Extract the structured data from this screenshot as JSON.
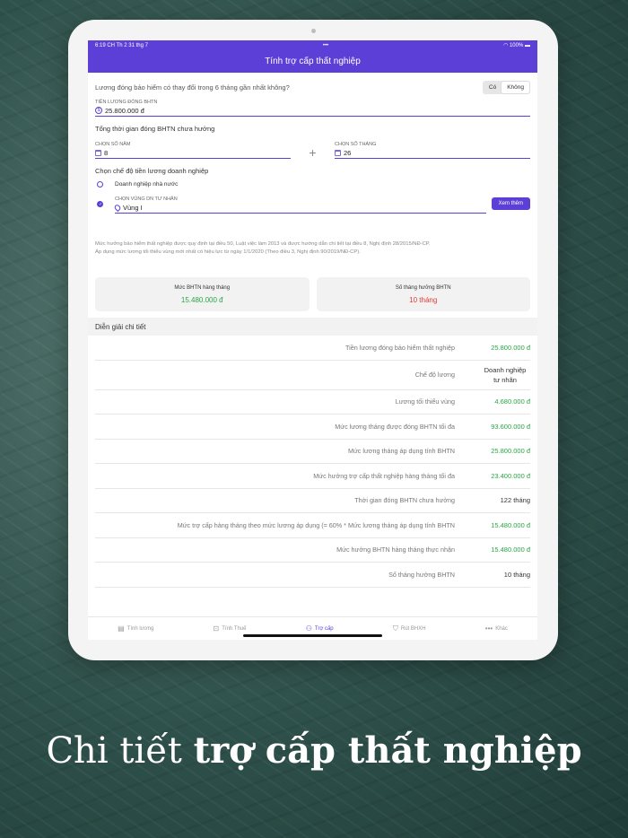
{
  "status": {
    "time": "6:19 CH",
    "date": "Th 2 31 thg 7",
    "dots": "•••",
    "battery": "100%"
  },
  "title": "Tính trợ cấp thất nghiệp",
  "question": {
    "text": "Lương đóng bảo hiểm có thay đổi trong 6 tháng gần nhất không?",
    "yes": "Có",
    "no": "Không",
    "selected": "Không"
  },
  "salary": {
    "label": "TIỀN LƯƠNG ĐÓNG BHTN",
    "value": "25.800.000 đ"
  },
  "total_time": {
    "title": "Tổng thời gian đóng BHTN chưa hưởng",
    "years_label": "CHỌN SỐ NĂM",
    "years_value": "8",
    "months_label": "CHỌN SỐ THÁNG",
    "months_value": "26",
    "plus": "+"
  },
  "regime": {
    "title": "Chọn chế độ tiền lương doanh nghiệp",
    "option_state": "Doanh nghiệp nhà nước",
    "region_label": "CHỌN VÙNG DN TƯ NHÂN",
    "region_value": "Vùng I",
    "more_button": "Xem thêm"
  },
  "note": {
    "line1": "Mức hưởng bảo hiểm thất nghiệp được quy định tại điều 50, Luật việc làm 2013 và được hướng dẫn chi tiết tại điều 8, Nghị định 28/2015/NĐ-CP.",
    "line2": "Áp dụng mức lương tối thiểu vùng mới nhất có hiệu lực từ ngày 1/1/2020 (Theo điều 3, Nghị định 90/2019/NĐ-CP)."
  },
  "cards": {
    "monthly_title": "Mức BHTN hàng tháng",
    "monthly_value": "15.480.000 đ",
    "months_title": "Số tháng hưởng BHTN",
    "months_value": "10 tháng"
  },
  "detail": {
    "header": "Diễn giải chi tiết",
    "rows": [
      {
        "label": "Tiền lương đóng bảo hiểm thất nghiệp",
        "value": "25.800.000 đ"
      },
      {
        "label": "Chế độ lương",
        "value1": "Doanh nghiệp",
        "value2": "tư nhân"
      },
      {
        "label": "Lương tối thiểu vùng",
        "value": "4.680.000 đ"
      },
      {
        "label": "Mức lương tháng được đóng BHTN tối đa",
        "value": "93.600.000 đ"
      },
      {
        "label": "Mức lương tháng áp dụng tính BHTN",
        "value": "25.800.000 đ"
      },
      {
        "label": "Mức hưởng trợ cấp thất nghiệp hàng tháng tối đa",
        "value": "23.400.000 đ"
      },
      {
        "label": "Thời gian đóng BHTN chưa hưởng",
        "value": "122 tháng"
      },
      {
        "label": "Mức trợ cấp hàng tháng theo mức lương áp dụng (= 60% * Mức lương tháng áp dụng tính BHTN",
        "value": "15.480.000 đ"
      },
      {
        "label": "Mức hưởng BHTN hàng tháng thực nhận",
        "value": "15.480.000 đ"
      },
      {
        "label": "Số tháng hưởng BHTN",
        "value": "10 tháng"
      }
    ]
  },
  "tabs": [
    "Tính lương",
    "Tính Thuế",
    "Trợ cấp",
    "Rút BHXH",
    "Khác"
  ],
  "caption": {
    "regular": "Chi tiết ",
    "bold": "trợ cấp thất nghiệp"
  }
}
